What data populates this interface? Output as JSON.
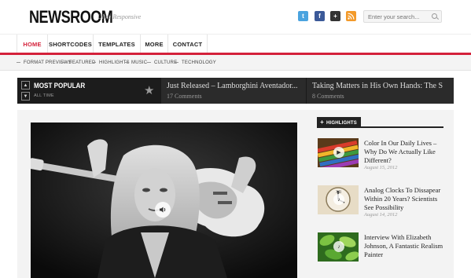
{
  "header": {
    "logo": "NEWSROOM",
    "tagline": "Ultra Responsive",
    "search_placeholder": "Enter your search...",
    "social": [
      "twitter-icon",
      "facebook-icon",
      "google-plus-icon",
      "rss-icon"
    ]
  },
  "main_nav": {
    "items": [
      {
        "label": "HOME",
        "active": true
      },
      {
        "label": "SHORTCODES"
      },
      {
        "label": "TEMPLATES"
      },
      {
        "label": "MORE"
      },
      {
        "label": "CONTACT"
      }
    ]
  },
  "sub_nav": {
    "items": [
      "FORMAT PREVIEWS",
      "FEATURED",
      "HIGHLIGHTS",
      "MUSIC",
      "CULTURE",
      "TECHNOLOGY"
    ]
  },
  "popular": {
    "title": "MOST POPULAR",
    "subtitle": "ALL TIME",
    "items": [
      {
        "title": "Just Released – Lamborghini Aventador...",
        "meta": "17 Comments"
      },
      {
        "title": "Taking Matters in His Own Hands: The S",
        "meta": "8 Comments"
      }
    ]
  },
  "highlights": {
    "label": "HIGHLIGHTS",
    "items": [
      {
        "title": "Color In Our Daily Lives – Why Do We Actually Like Different?",
        "date": "August 15, 2012"
      },
      {
        "title": "Analog Clocks To Dissapear Within 20 Years? Scientists See Possibility",
        "date": "August 14, 2012"
      },
      {
        "title": "Interview With Elizabeth Johnson, A Fantastic Realism Painter",
        "date": "August 13, 2012"
      }
    ]
  },
  "colors": {
    "accent": "#d4213a",
    "dark_bar": "#2b2b2b"
  }
}
